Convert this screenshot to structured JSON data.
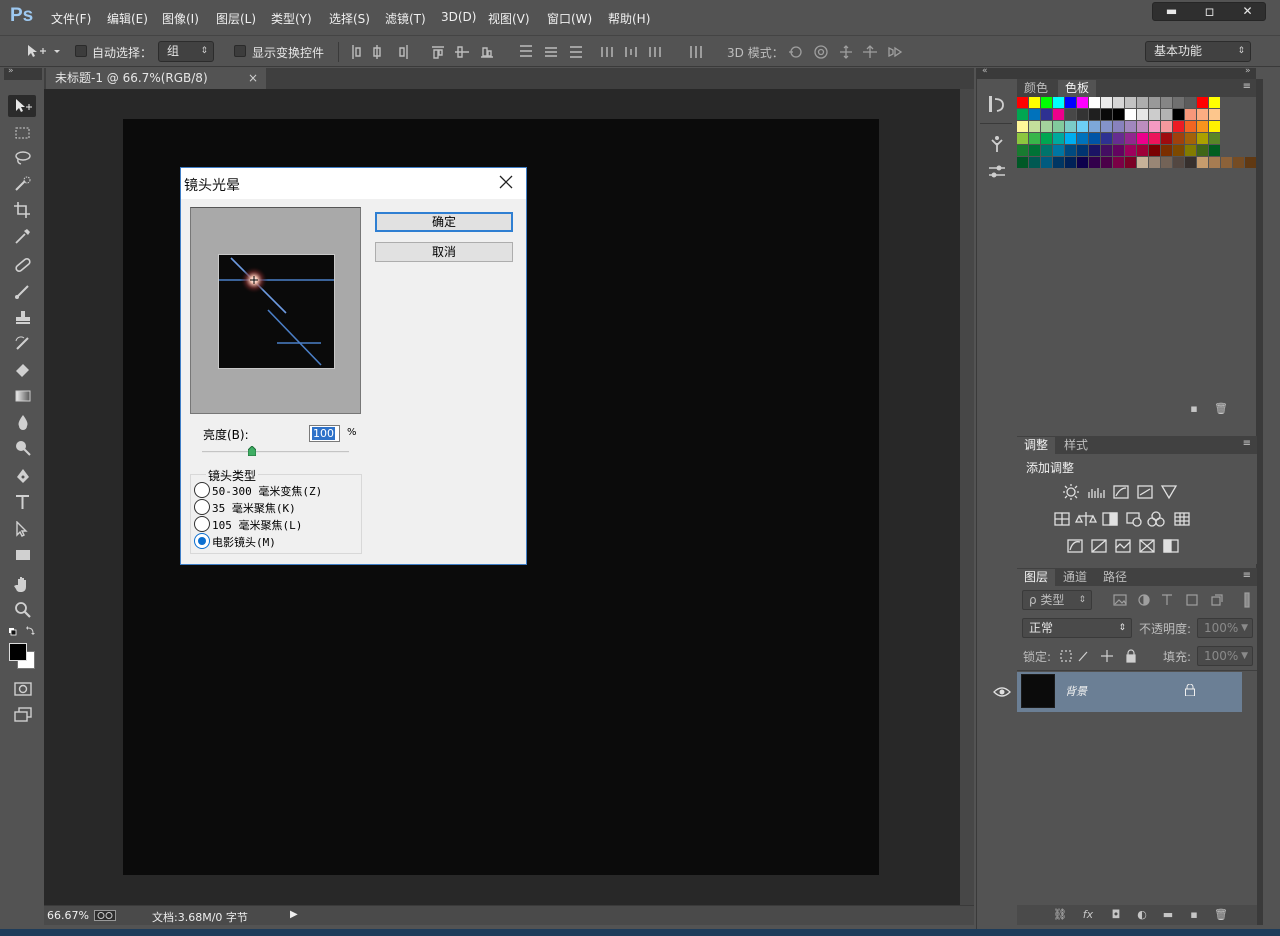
{
  "app": {
    "logo": "Ps"
  },
  "menu": [
    "文件(F)",
    "编辑(E)",
    "图像(I)",
    "图层(L)",
    "类型(Y)",
    "选择(S)",
    "滤镜(T)",
    "3D(D)",
    "视图(V)",
    "窗口(W)",
    "帮助(H)"
  ],
  "window_controls": {
    "minimize": "▬",
    "restore": "▫",
    "close": "✕"
  },
  "options": {
    "auto_select_label": "自动选择：",
    "auto_select_value": "组",
    "show_transform_label": "显示变换控件",
    "mode_3d_label": "3D 模式：",
    "workspace": "基本功能"
  },
  "document": {
    "tab_title": "未标题-1 @ 66.7%(RGB/8)",
    "tab_close": "×",
    "zoom": "66.67%",
    "doc_info": "文档:3.68M/0 字节"
  },
  "dialog": {
    "title": "镜头光晕",
    "ok": "确定",
    "cancel": "取消",
    "brightness_label": "亮度(B):",
    "brightness_value": "100",
    "brightness_unit": "%",
    "brightness_level": 1.0,
    "lens_type_legend": "镜头类型",
    "lens_types": [
      "50-300 毫米变焦(Z)",
      "35 毫米聚焦(K)",
      "105 毫米聚焦(L)",
      "电影镜头(M)"
    ],
    "selected_lens": 3
  },
  "panels": {
    "color_tabs": [
      "颜色",
      "色板"
    ],
    "adjust_tabs": [
      "调整",
      "样式"
    ],
    "adjust_title": "添加调整",
    "layer_tabs": [
      "图层",
      "通道",
      "路径"
    ],
    "filter_kind": "ρ 类型",
    "blend_mode": "正常",
    "opacity_label": "不透明度:",
    "opacity_value": "100%",
    "lock_label": "锁定:",
    "fill_label": "填充:",
    "fill_value": "100%",
    "layer_name": "背景"
  },
  "colors": {
    "app_bg": "#535353",
    "canvas_bg": "#0b0b0b",
    "accent": "#2f7fd2",
    "layer_selected": "#6b7f95"
  }
}
